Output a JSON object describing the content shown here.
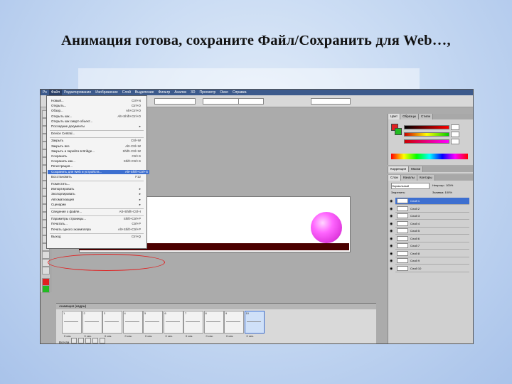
{
  "slide": {
    "title": "Анимация готова, сохраните Файл/Сохранить для Web…,"
  },
  "menubar": {
    "items": [
      "Ps",
      "Файл",
      "Редактирование",
      "Изображение",
      "Слой",
      "Выделение",
      "Фильтр",
      "Анализ",
      "3D",
      "Просмотр",
      "Окно",
      "Справка"
    ]
  },
  "options": {
    "field1": "",
    "field2": "",
    "btn1": "",
    "btn2": "",
    "mode": ""
  },
  "file_menu": {
    "items": [
      {
        "label": "Новый...",
        "shortcut": "Ctrl+N"
      },
      {
        "label": "Открыть...",
        "shortcut": "Ctrl+O"
      },
      {
        "label": "Обзор...",
        "shortcut": "Alt+Ctrl+O"
      },
      {
        "label": "Открыть как...",
        "shortcut": "Alt+Shift+Ctrl+O"
      },
      {
        "label": "Открыть как смарт-объект...",
        "shortcut": ""
      },
      {
        "label": "Последние документы",
        "shortcut": "▸"
      },
      {
        "label": "Device Central...",
        "shortcut": ""
      },
      {
        "label": "Закрыть",
        "shortcut": "Ctrl+W"
      },
      {
        "label": "Закрыть все",
        "shortcut": "Alt+Ctrl+W"
      },
      {
        "label": "Закрыть и перейти в Bridge...",
        "shortcut": "Shift+Ctrl+W"
      },
      {
        "label": "Сохранить",
        "shortcut": "Ctrl+S"
      },
      {
        "label": "Сохранить как...",
        "shortcut": "Shift+Ctrl+S"
      },
      {
        "label": "Регистрация...",
        "shortcut": ""
      },
      {
        "label": "Сохранить для Web и устройств...",
        "shortcut": "Alt+Shift+Ctrl+S"
      },
      {
        "label": "Восстановить",
        "shortcut": "F12"
      },
      {
        "label": "Поместить...",
        "shortcut": ""
      },
      {
        "label": "Импортировать",
        "shortcut": "▸"
      },
      {
        "label": "Экспортировать",
        "shortcut": "▸"
      },
      {
        "label": "Автоматизация",
        "shortcut": "▸"
      },
      {
        "label": "Сценарии",
        "shortcut": "▸"
      },
      {
        "label": "Сведения о файле...",
        "shortcut": "Alt+Shift+Ctrl+I"
      },
      {
        "label": "Параметры страницы...",
        "shortcut": "Shift+Ctrl+P"
      },
      {
        "label": "Печатать...",
        "shortcut": "Ctrl+P"
      },
      {
        "label": "Печать одного экземпляра",
        "shortcut": "Alt+Shift+Ctrl+P"
      },
      {
        "label": "Выход",
        "shortcut": "Ctrl+Q"
      }
    ],
    "highlighted_index": 13
  },
  "animation": {
    "title": "Анимация (кадры)",
    "frames": [
      "1",
      "2",
      "3",
      "4",
      "5",
      "6",
      "7",
      "8",
      "9",
      "10"
    ],
    "delays": [
      "0 сек.",
      "0 сек.",
      "0 сек.",
      "0 сек.",
      "0 сек.",
      "0 сек.",
      "0 сек.",
      "0 сек.",
      "0 сек.",
      "0 сек."
    ],
    "selected_index": 9,
    "loop": "Всегда"
  },
  "panels": {
    "color_tabs": [
      "Цвет",
      "Образцы",
      "Стили"
    ],
    "color_values": [
      "",
      "",
      ""
    ],
    "adjust_tabs": [
      "Коррекция",
      "Маски"
    ],
    "layers_tabs": [
      "Слои",
      "Каналы",
      "Контуры"
    ],
    "blend": "Нормальный",
    "opacity_label": "Непрозр.: 100%",
    "lock_label": "Закрепить:",
    "fill_label": "Заливка: 100%",
    "layers": [
      "Слой 1",
      "Слой 2",
      "Слой 3",
      "Слой 4",
      "Слой 5",
      "Слой 6",
      "Слой 7",
      "Слой 8",
      "Слой 9",
      "Слой 10"
    ],
    "selected_layer": 0
  },
  "colors": {
    "accent": "#3d6fd0",
    "menubar": "#3c5a8c",
    "sphere": "#ff66ff",
    "highlight_oval": "#e02020",
    "doc_bar": "#4b0000"
  }
}
